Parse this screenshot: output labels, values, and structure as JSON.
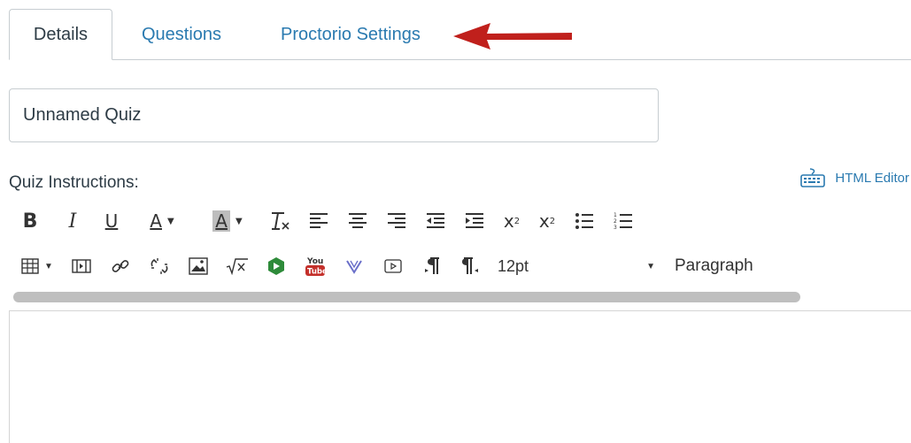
{
  "tabs": [
    {
      "label": "Details",
      "active": true
    },
    {
      "label": "Questions",
      "active": false
    },
    {
      "label": "Proctorio Settings",
      "active": false
    }
  ],
  "quiz": {
    "title_value": "Unnamed Quiz",
    "instructions_label": "Quiz Instructions:",
    "html_editor_label": "HTML Editor"
  },
  "toolbar": {
    "font_size": "12pt",
    "format": "Paragraph",
    "font_color_glyph": "A",
    "highlight_glyph": "A",
    "bold_glyph": "B",
    "italic_glyph": "I",
    "underline_glyph": "U"
  },
  "colors": {
    "link": "#2a7ab0",
    "text": "#2d3b45",
    "arrow": "#c0201c",
    "border": "#c7cdd1"
  }
}
